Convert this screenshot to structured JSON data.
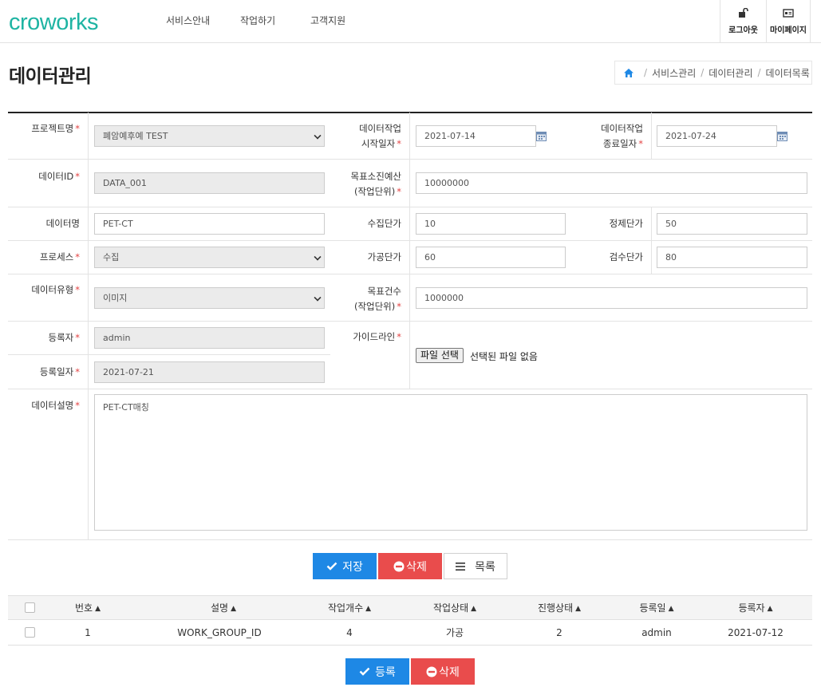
{
  "header": {
    "logo": "croworks",
    "nav": [
      "서비스안내",
      "작업하기",
      "고객지원"
    ],
    "logout": "로그아웃",
    "mypage": "마이페이지"
  },
  "page": {
    "title": "데이터관리",
    "breadcrumb": [
      "서비스관리",
      "데이터관리",
      "데이터목록"
    ]
  },
  "form": {
    "project_label": "프로젝트명",
    "project_value": "폐암예후예 TEST",
    "start_label_1": "데이터작업",
    "start_label_2": "시작일자",
    "start_value": "2021-07-14",
    "end_label_1": "데이터작업",
    "end_label_2": "종료일자",
    "end_value": "2021-07-24",
    "data_id_label": "데이터ID",
    "data_id_value": "DATA_001",
    "budget_label_1": "목표소진예산",
    "budget_label_2": "(작업단위)",
    "budget_value": "10000000",
    "data_name_label": "데이터명",
    "data_name_value": "PET-CT",
    "collect_price_label": "수집단가",
    "collect_price_value": "10",
    "refine_price_label": "정제단가",
    "refine_price_value": "50",
    "process_label": "프로세스",
    "process_value": "수집",
    "process_price_label": "가공단가",
    "process_price_value": "60",
    "inspect_price_label": "검수단가",
    "inspect_price_value": "80",
    "data_type_label": "데이터유형",
    "data_type_value": "이미지",
    "target_count_label_1": "목표건수",
    "target_count_label_2": "(작업단위)",
    "target_count_value": "1000000",
    "registrant_label": "등록자",
    "registrant_value": "admin",
    "reg_date_label": "등록일자",
    "reg_date_value": "2021-07-21",
    "guideline_label": "가이드라인",
    "file_button": "파일 선택",
    "file_status": "선택된 파일 없음",
    "desc_label": "데이터설명",
    "desc_value": "PET-CT매칭",
    "required_mark": "*"
  },
  "actions": {
    "save": "저장",
    "delete": "삭제",
    "list": "목록"
  },
  "table": {
    "headers": [
      "번호",
      "설명",
      "작업개수",
      "작업상태",
      "진행상태",
      "등록일",
      "등록자"
    ],
    "rows": [
      [
        "1",
        "WORK_GROUP_ID",
        "4",
        "가공",
        "2",
        "admin",
        "2021-07-12"
      ]
    ]
  },
  "table_actions": {
    "register": "등록",
    "delete": "삭제"
  },
  "colors": {
    "brand": "#1fb4a3",
    "primary": "#1e88e5",
    "danger": "#e94c4c",
    "required": "#e34343"
  }
}
